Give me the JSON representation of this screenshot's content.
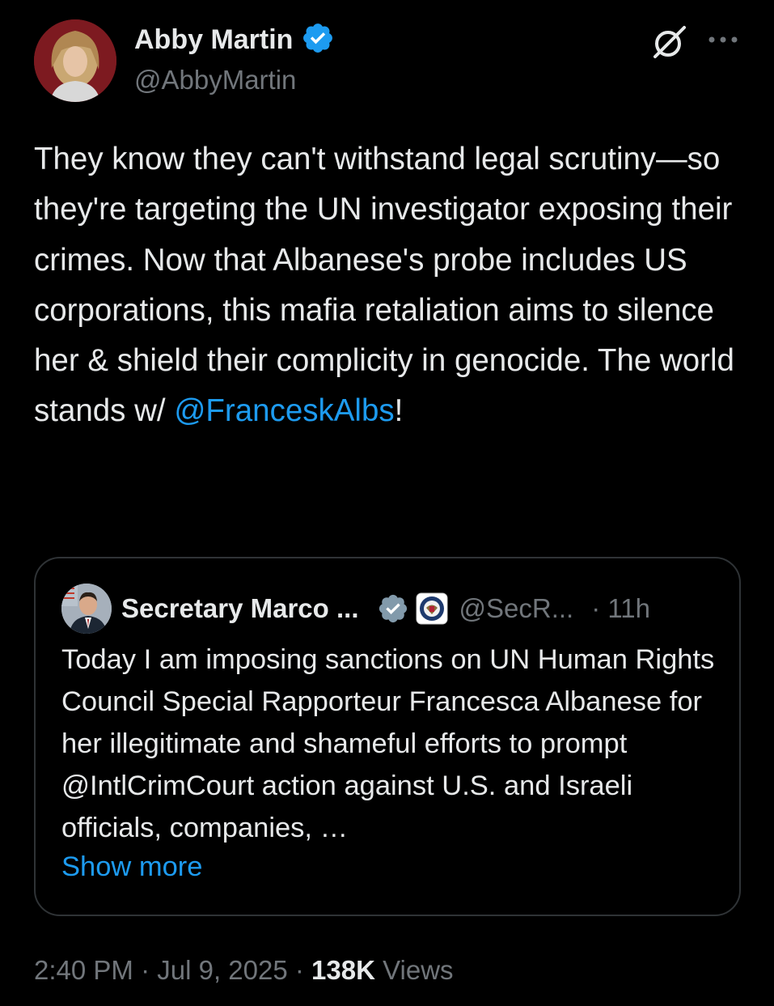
{
  "author": {
    "name": "Abby Martin",
    "handle": "@AbbyMartin",
    "verified_icon": "verified-badge-icon",
    "accent_color": "#1d9bf0"
  },
  "tweet": {
    "text_before_mention": "They know they can't withstand legal scrutiny—so they're targeting the UN investigator exposing their crimes. Now that Albanese's probe includes US corporations, this mafia retaliation aims to silence her & shield their complicity in genocide. The world stands w/ ",
    "mention": "@FranceskAlbs",
    "text_after_mention": "!"
  },
  "quote": {
    "name": "Secretary Marco ...",
    "handle": "@SecR...",
    "time": "· 11h",
    "text": "Today I am imposing sanctions on UN Human Rights Council Special Rapporteur Francesca Albanese for her illegitimate and shameful efforts to prompt @IntlCrimCourt action against U.S. and Israeli officials, companies, …",
    "show_more": "Show more"
  },
  "meta": {
    "time": "2:40 PM",
    "separator": " · ",
    "date": "Jul 9, 2025",
    "views_count": "138K",
    "views_label": "Views"
  },
  "icons": {
    "grok": "grok-icon",
    "more": "more-options-icon"
  }
}
